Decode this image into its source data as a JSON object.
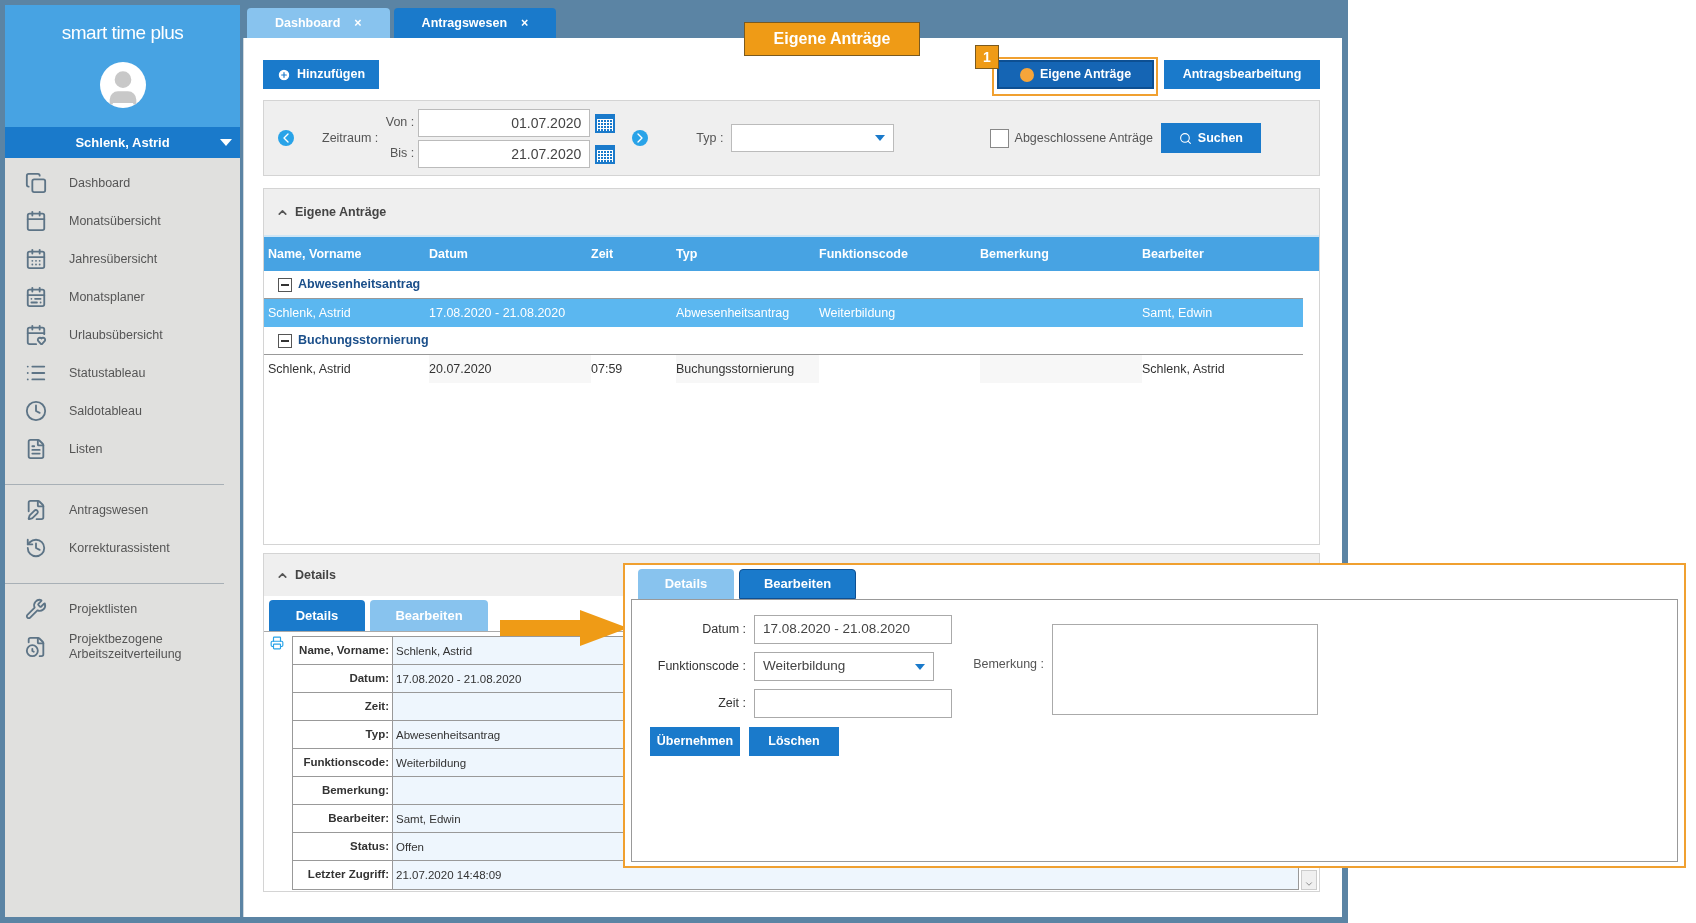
{
  "sidebar": {
    "app_title": "smart time plus",
    "user_name": "Schlenk, Astrid",
    "menu_groups": [
      {
        "items": [
          "Dashboard",
          "Monatsübersicht",
          "Jahresübersicht",
          "Monatsplaner",
          "Urlaubsübersicht",
          "Statustableau",
          "Saldotableau",
          "Listen"
        ]
      },
      {
        "items": [
          "Antragswesen",
          "Korrekturassistent"
        ]
      },
      {
        "items": [
          "Projektlisten",
          "Projektbezogene Arbeitszeitverteilung"
        ]
      }
    ]
  },
  "tabs": [
    {
      "label": "Dashboard",
      "close": "×",
      "selected": false
    },
    {
      "label": "Antragswesen",
      "close": "×",
      "selected": true
    }
  ],
  "toolbar": {
    "add_button": "Hinzufügen",
    "view_buttons": [
      {
        "label": "Eigene Anträge",
        "selected": true
      },
      {
        "label": "Antragsbearbeitung",
        "selected": false
      }
    ]
  },
  "filter": {
    "period_label": "Zeitraum :",
    "from_label": "Von :",
    "from_value": "01.07.2020",
    "to_label": "Bis :",
    "to_value": "21.07.2020",
    "type_label": "Typ :",
    "closed_checkbox": {
      "label": "Abgeschlossene Anträge",
      "checked": false
    },
    "search_button": "Suchen"
  },
  "requests": {
    "title": "Eigene Anträge",
    "columns": [
      "Name, Vorname",
      "Datum",
      "Zeit",
      "Typ",
      "Funktionscode",
      "Bemerkung",
      "Bearbeiter"
    ],
    "groups": [
      {
        "label": "Abwesenheitsantrag",
        "expanded": true,
        "rows": [
          {
            "selected": true,
            "cells": [
              "Schlenk, Astrid",
              "17.08.2020 - 21.08.2020",
              null,
              "Abwesenheitsantrag",
              "Weiterbildung",
              null,
              "Samt, Edwin"
            ]
          }
        ]
      },
      {
        "label": "Buchungsstornierung",
        "expanded": true,
        "rows": [
          {
            "selected": false,
            "cells": [
              "Schlenk, Astrid",
              "20.07.2020",
              "07:59",
              "Buchungsstornierung",
              null,
              null,
              "Schlenk, Astrid"
            ]
          }
        ]
      }
    ]
  },
  "details": {
    "title": "Details",
    "tabs": [
      {
        "label": "Details",
        "selected": true
      },
      {
        "label": "Bearbeiten",
        "selected": false
      }
    ],
    "fields": [
      {
        "label": "Name, Vorname:",
        "value": "Schlenk, Astrid"
      },
      {
        "label": "Datum:",
        "value": "17.08.2020 - 21.08.2020"
      },
      {
        "label": "Zeit:"
      },
      {
        "label": "Typ:",
        "value": "Abwesenheitsantrag"
      },
      {
        "label": "Funktionscode:",
        "value": "Weiterbildung"
      },
      {
        "label": "Bemerkung:"
      },
      {
        "label": "Bearbeiter:",
        "value": "Samt, Edwin"
      },
      {
        "label": "Status:",
        "value": "Offen"
      },
      {
        "label": "Letzter Zugriff:",
        "value": "21.07.2020 14:48:09"
      }
    ]
  },
  "edit_panel": {
    "tabs": [
      {
        "label": "Details",
        "selected": false
      },
      {
        "label": "Bearbeiten",
        "selected": true
      }
    ],
    "date_label": "Datum :",
    "date_value": "17.08.2020 - 21.08.2020",
    "function_label": "Funktionscode :",
    "function_value": "Weiterbildung",
    "time_label": "Zeit :",
    "remark_label": "Bemerkung :",
    "buttons": [
      "Übernehmen",
      "Löschen"
    ]
  },
  "annotation": {
    "callout": "Eigene Anträge",
    "step": "1"
  }
}
